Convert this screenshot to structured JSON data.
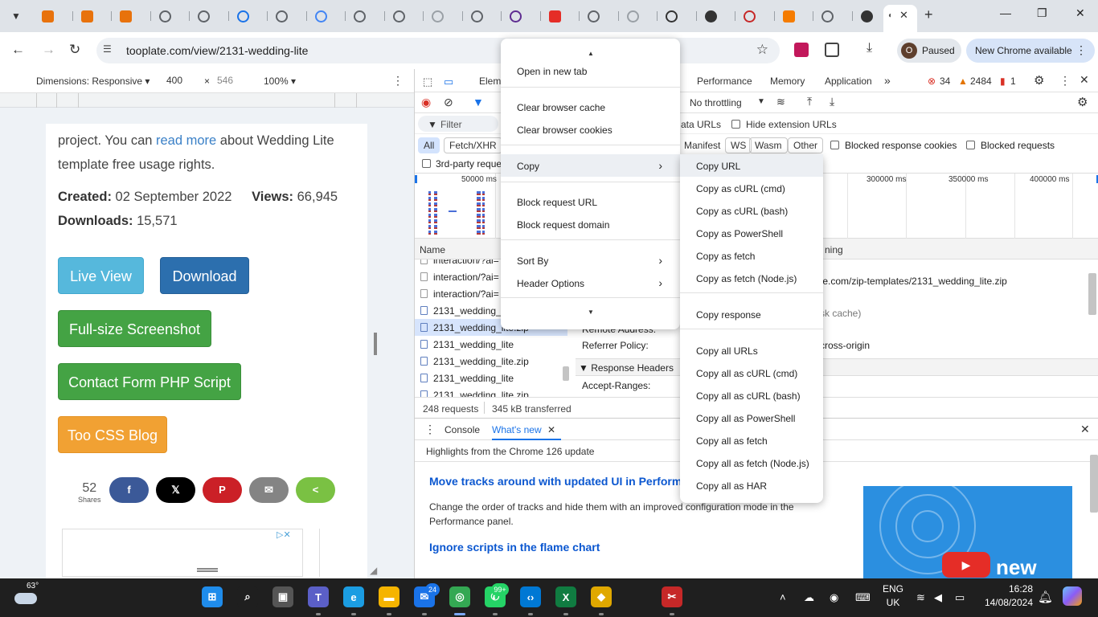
{
  "browser": {
    "active_tab": {
      "close": "✕"
    },
    "new_tab": "+",
    "window_controls": [
      "—",
      "❐",
      "✕"
    ],
    "url": "tooplate.com/view/2131-wedding-lite",
    "profile": {
      "initial": "O",
      "label": "Paused"
    },
    "update_label": "New Chrome available",
    "tab_favicons": [
      {
        "icon": "tooplate-icon",
        "color": "#e8720c"
      },
      {
        "icon": "tooplate-icon",
        "color": "#e8720c"
      },
      {
        "icon": "tooplate-icon",
        "color": "#e8720c"
      },
      {
        "icon": "globe-icon",
        "color": "#5f6368"
      },
      {
        "icon": "globe-icon",
        "color": "#5f6368"
      },
      {
        "icon": "globe-icon",
        "color": "#1a73e8"
      },
      {
        "icon": "globe-icon",
        "color": "#5f6368"
      },
      {
        "icon": "google-icon",
        "color": "#4285f4"
      },
      {
        "icon": "globe-icon",
        "color": "#5f6368"
      },
      {
        "icon": "globe-icon",
        "color": "#5f6368"
      },
      {
        "icon": "globe-icon",
        "color": "#9aa0a6"
      },
      {
        "icon": "globe-icon",
        "color": "#5f6368"
      },
      {
        "icon": "globe-icon",
        "color": "#5f2d91"
      },
      {
        "icon": "youtube-icon",
        "color": "#e52d27"
      },
      {
        "icon": "globe-icon",
        "color": "#5f6368"
      },
      {
        "icon": "globe-icon",
        "color": "#9aa0a6"
      },
      {
        "icon": "globe-icon",
        "color": "#333333"
      },
      {
        "icon": "openai-icon",
        "color": "#333333"
      },
      {
        "icon": "globe-icon",
        "color": "#c62828"
      },
      {
        "icon": "box-icon",
        "color": "#f57c00"
      },
      {
        "icon": "globe-icon",
        "color": "#5f6368"
      },
      {
        "icon": "openai-icon",
        "color": "#333333"
      }
    ]
  },
  "device_toolbar": {
    "dimensions": "Dimensions: Responsive ▾",
    "width": "400",
    "times": "×",
    "height": "546",
    "zoom": "100% ▾"
  },
  "page": {
    "intro_line1_pre": "project. You can ",
    "intro_link": "read more",
    "intro_line1_post": " about Wedding Lite",
    "intro_line2": "template free usage rights.",
    "created_label": "Created:",
    "created_value": " 02 September 2022",
    "views_label": "Views:",
    "views_value": " 66,945",
    "downloads_label": "Downloads:",
    "downloads_value": " 15,571",
    "live_view": "Live View",
    "download": "Download",
    "screenshot": "Full-size Screenshot",
    "contact": "Contact Form PHP Script",
    "blog": "Too CSS Blog",
    "share_count": "52",
    "share_label": "Shares",
    "share_buttons": [
      {
        "icon": "facebook-icon",
        "glyph": "f",
        "color": "#3b5998"
      },
      {
        "icon": "x-icon",
        "glyph": "𝕏",
        "color": "#000000"
      },
      {
        "icon": "pinterest-icon",
        "glyph": "P",
        "color": "#cb2027"
      },
      {
        "icon": "email-icon",
        "glyph": "✉",
        "color": "#848484"
      },
      {
        "icon": "share-icon",
        "glyph": "<",
        "color": "#7ac143"
      }
    ]
  },
  "devtools": {
    "tabs": [
      "Elem",
      "Performance",
      "Memory",
      "Application",
      "»"
    ],
    "errors": "34",
    "warnings": "2484",
    "issues": "1",
    "throttling": "No throttling",
    "filter_placeholder": "Filter",
    "data_urls": "ata URLs",
    "hide_ext": "Hide extension URLs",
    "type_chips": [
      "All",
      "Fetch/XHR",
      "Manifest",
      "WS",
      "Wasm",
      "Other"
    ],
    "blocked_cookies": "Blocked response cookies",
    "blocked_requests": "Blocked requests",
    "third_party": "3rd-party reque",
    "ticks": [
      "50000 ms",
      "300000 ms",
      "350000 ms",
      "400000 ms"
    ],
    "col_name": "Name",
    "col_timing": "ning",
    "rows": [
      "interaction/?ai=",
      "interaction/?ai=",
      "interaction/?ai=",
      "2131_wedding_l",
      "2131_wedding_lite.zip",
      "2131_wedding_lite",
      "2131_wedding_lite.zip",
      "2131_wedding_lite",
      "2131_wedding_lite.zip"
    ],
    "detail_url": "te.com/zip-templates/2131_wedding_lite.zip",
    "detail_cache": "sk cache)",
    "remote_address": "Remote Address:",
    "referrer_policy": "Referrer Policy:",
    "referrer_value": "cross-origin",
    "response_headers": "▼ Response Headers",
    "accept_ranges": "Accept-Ranges:",
    "requests": "248 requests",
    "transferred": "345 kB transferred",
    "drawer_tabs": [
      "Console",
      "What's new"
    ],
    "highlights": "Highlights from the Chrome 126 update",
    "news1_title": "Move tracks around with updated UI in Perform",
    "news1_body_1": "Change the order of tracks and hide them with an improved configuration mode in the",
    "news1_body_2": "Performance panel.",
    "news2_title": "Ignore scripts in the flame chart",
    "video_label": "new"
  },
  "context_menu": {
    "items": [
      "Open in new tab",
      "Clear browser cache",
      "Clear browser cookies",
      "Copy",
      "Block request URL",
      "Block request domain",
      "Sort By",
      "Header Options"
    ],
    "copy_items": [
      "Copy URL",
      "Copy as cURL (cmd)",
      "Copy as cURL (bash)",
      "Copy as PowerShell",
      "Copy as fetch",
      "Copy as fetch (Node.js)",
      "Copy response",
      "Copy all URLs",
      "Copy all as cURL (cmd)",
      "Copy all as cURL (bash)",
      "Copy all as PowerShell",
      "Copy all as fetch",
      "Copy all as fetch (Node.js)",
      "Copy all as HAR"
    ]
  },
  "taskbar": {
    "temperature": "63°",
    "mail_badge": "24",
    "whatsapp_badge": "99+",
    "lang_1": "ENG",
    "lang_2": "UK",
    "time": "16:28",
    "date": "14/08/2024",
    "apps": [
      {
        "icon": "windows-start-icon",
        "color": "#1f8ceb"
      },
      {
        "icon": "search-icon",
        "color": "#1f1f1f"
      },
      {
        "icon": "task-view-icon",
        "color": "#555555"
      },
      {
        "icon": "teams-icon",
        "color": "#5b5fc7"
      },
      {
        "icon": "edge-icon",
        "color": "#1b9de2"
      },
      {
        "icon": "file-explorer-icon",
        "color": "#f5b400"
      },
      {
        "icon": "mail-icon",
        "color": "#1a73e8"
      },
      {
        "icon": "chrome-icon",
        "color": "#34a853"
      },
      {
        "icon": "whatsapp-icon",
        "color": "#25d366"
      },
      {
        "icon": "vscode-icon",
        "color": "#0078d4"
      },
      {
        "icon": "excel-icon",
        "color": "#107c41"
      },
      {
        "icon": "app-icon",
        "color": "#e0a800"
      },
      {
        "icon": "snipping-tool-icon",
        "color": "#c62828"
      }
    ]
  }
}
